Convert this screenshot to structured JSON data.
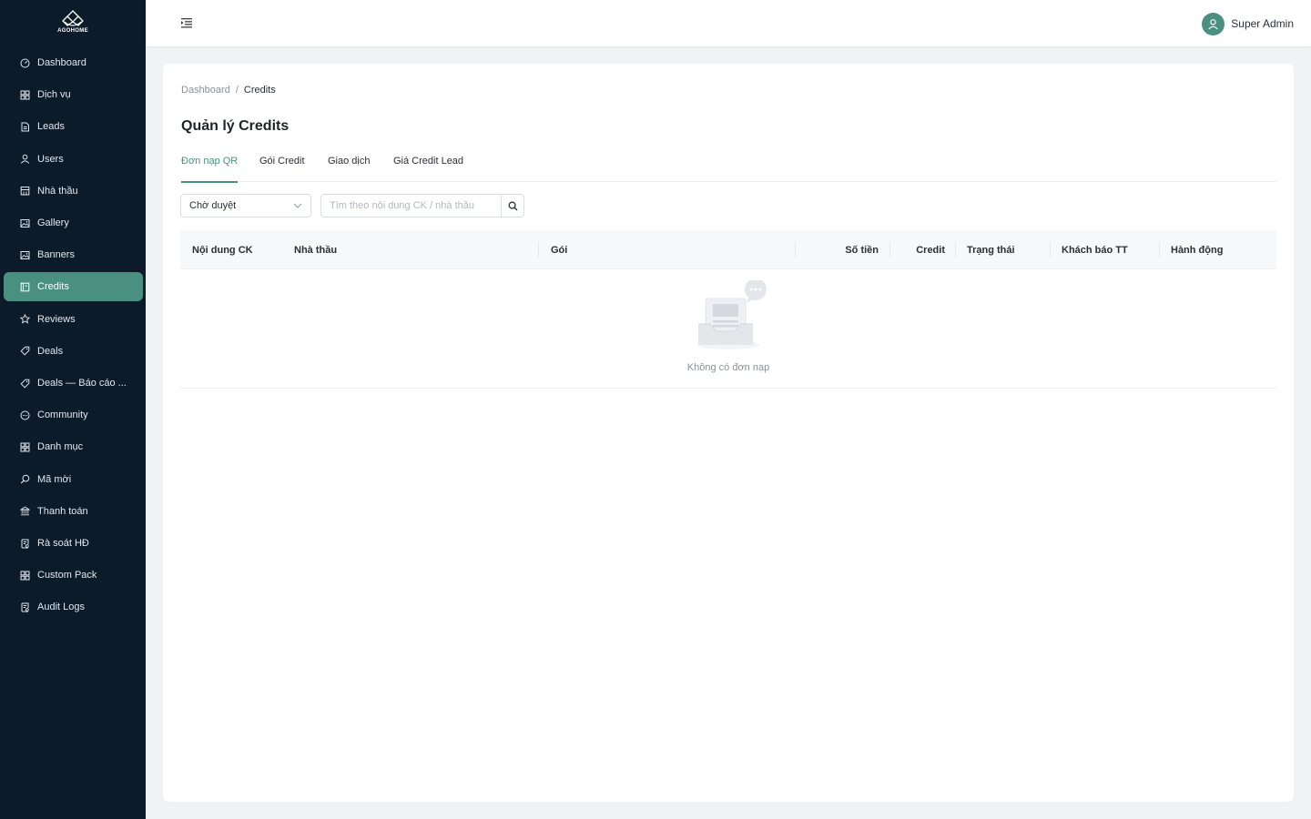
{
  "brand": {
    "logo_text": "AGOHOME"
  },
  "sidebar": {
    "items": [
      {
        "label": "Dashboard",
        "icon": "dashboard-icon"
      },
      {
        "label": "Dịch vụ",
        "icon": "grid-icon"
      },
      {
        "label": "Leads",
        "icon": "document-icon"
      },
      {
        "label": "Users",
        "icon": "user-icon"
      },
      {
        "label": "Nhà thầu",
        "icon": "building-icon"
      },
      {
        "label": "Gallery",
        "icon": "image-icon"
      },
      {
        "label": "Banners",
        "icon": "image-icon"
      },
      {
        "label": "Credits",
        "icon": "wallet-icon",
        "active": true
      },
      {
        "label": "Reviews",
        "icon": "star-icon"
      },
      {
        "label": "Deals",
        "icon": "tag-icon"
      },
      {
        "label": "Deals — Báo cáo ...",
        "icon": "tag-icon"
      },
      {
        "label": "Community",
        "icon": "chat-icon"
      },
      {
        "label": "Danh mục",
        "icon": "grid-icon"
      },
      {
        "label": "Mã mời",
        "icon": "search-icon"
      },
      {
        "label": "Thanh toán",
        "icon": "bank-icon"
      },
      {
        "label": "Rà soát HĐ",
        "icon": "audit-icon"
      },
      {
        "label": "Custom Pack",
        "icon": "grid-icon"
      },
      {
        "label": "Audit Logs",
        "icon": "audit-icon"
      }
    ]
  },
  "header": {
    "user_name": "Super Admin"
  },
  "breadcrumb": {
    "root": "Dashboard",
    "separator": "/",
    "current": "Credits"
  },
  "page": {
    "title": "Quản lý Credits"
  },
  "tabs": [
    {
      "label": "Đơn nạp QR",
      "active": true
    },
    {
      "label": "Gói Credit"
    },
    {
      "label": "Giao dịch"
    },
    {
      "label": "Giá Credit Lead"
    }
  ],
  "filters": {
    "status_value": "Chờ duyệt",
    "search_placeholder": "Tìm theo nội dung CK / nhà thầu"
  },
  "table": {
    "columns": [
      "Nội dung CK",
      "Nhà thầu",
      "Gói",
      "Số tiền",
      "Credit",
      "Trạng thái",
      "Khách báo TT",
      "Hành động"
    ],
    "empty_text": "Không có đơn nạp"
  },
  "colors": {
    "sidebar_bg": "#0c1b2a",
    "accent": "#4a9080",
    "page_bg": "#f1f2f4"
  }
}
